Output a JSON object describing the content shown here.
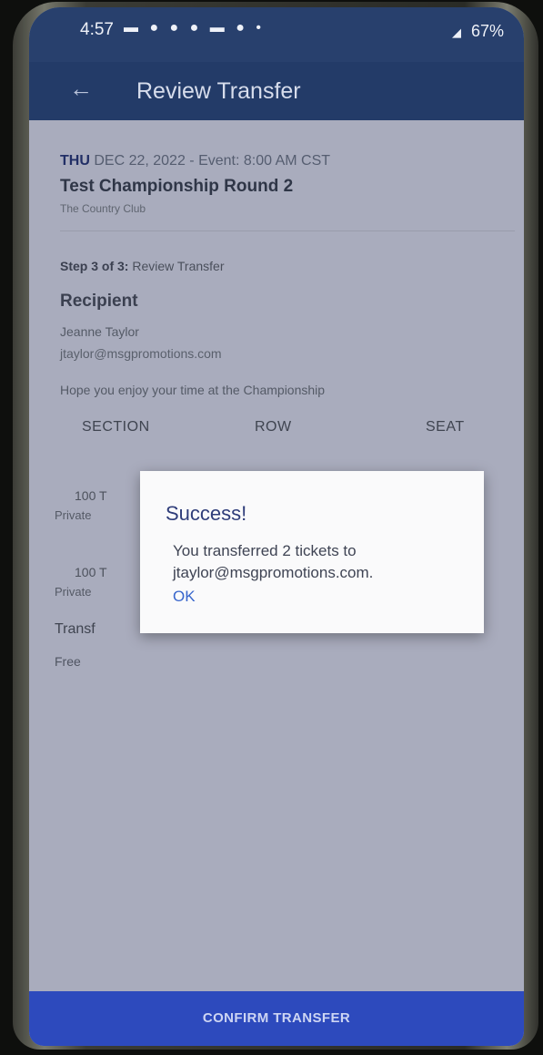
{
  "status_bar": {
    "time": "4:57",
    "icons": "▬ ● ● ● ▬ ● •",
    "battery": "67%"
  },
  "header": {
    "title": "Review Transfer"
  },
  "event": {
    "day": "THU",
    "date_time": "DEC 22, 2022 - Event: 8:00 AM CST",
    "name": "Test Championship Round 2",
    "venue": "The Country Club"
  },
  "step": {
    "label": "Step 3 of 3:",
    "text": "Review Transfer"
  },
  "recipient": {
    "heading": "Recipient",
    "name": "Jeanne Taylor",
    "email": "jtaylor@msgpromotions.com",
    "message": "Hope you enjoy your time at the Championship"
  },
  "tickets": {
    "headers": [
      "SECTION",
      "ROW",
      "SEAT"
    ],
    "rows": [
      {
        "section": "100 T",
        "type": "Private"
      },
      {
        "section": "100 T",
        "type": "Private"
      }
    ]
  },
  "fee": {
    "label": "Transf",
    "value": "Free"
  },
  "dialog": {
    "title": "Success!",
    "message_line1": "You transferred 2 tickets to",
    "message_line2": "jtaylor@msgpromotions.com.",
    "ok": "OK"
  },
  "footer": {
    "confirm": "CONFIRM TRANSFER"
  }
}
